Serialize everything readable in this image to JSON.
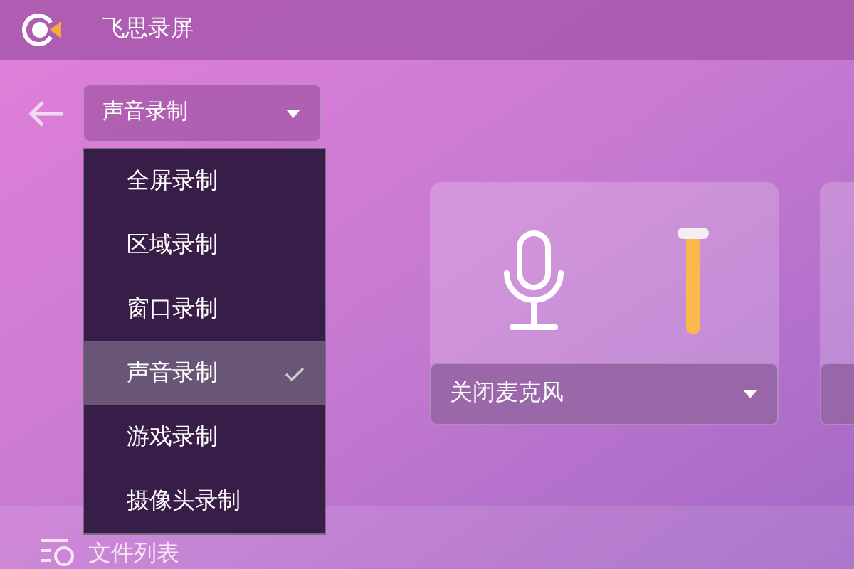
{
  "window": {
    "title": "飞思录屏"
  },
  "mode_select": {
    "value": "声音录制",
    "expanded": true
  },
  "mode_menu": [
    {
      "label": "全屏录制",
      "selected": false
    },
    {
      "label": "区域录制",
      "selected": false
    },
    {
      "label": "窗口录制",
      "selected": false
    },
    {
      "label": "声音录制",
      "selected": true
    },
    {
      "label": "游戏录制",
      "selected": false
    },
    {
      "label": "摄像头录制",
      "selected": false
    }
  ],
  "microphone": {
    "volume": {
      "level": 1
    },
    "option": "关闭麦克风"
  },
  "footer": {
    "label": "文件列表"
  }
}
